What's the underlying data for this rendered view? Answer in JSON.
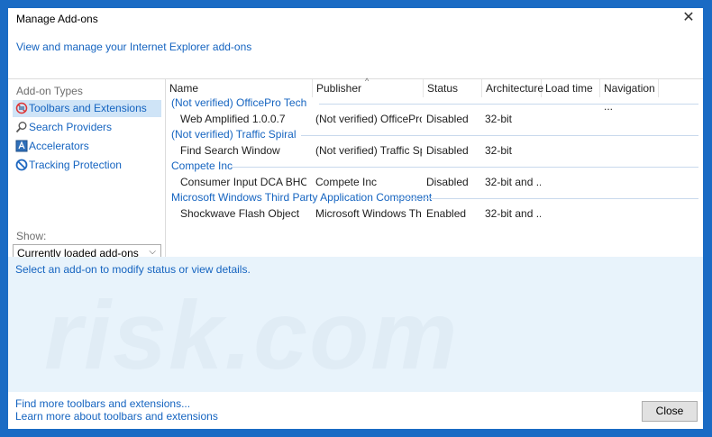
{
  "window": {
    "title": "Manage Add-ons",
    "subtitle": "View and manage your Internet Explorer add-ons"
  },
  "sidebar": {
    "group_label": "Add-on Types",
    "items": [
      {
        "label": "Toolbars and Extensions",
        "icon": "toolbar-icon",
        "selected": true
      },
      {
        "label": "Search Providers",
        "icon": "search-icon",
        "selected": false
      },
      {
        "label": "Accelerators",
        "icon": "accelerator-icon",
        "selected": false
      },
      {
        "label": "Tracking Protection",
        "icon": "block-icon",
        "selected": false
      }
    ],
    "show_label": "Show:",
    "show_value": "Currently loaded add-ons"
  },
  "table": {
    "columns": [
      "Name",
      "Publisher",
      "Status",
      "Architecture",
      "Load time",
      "Navigation ..."
    ],
    "groups": [
      {
        "name": "(Not verified) OfficePro Tech",
        "rows": [
          {
            "name": "Web Amplified 1.0.0.7",
            "publisher": "(Not verified) OfficePro T...",
            "status": "Disabled",
            "arch": "32-bit"
          }
        ]
      },
      {
        "name": "(Not verified) Traffic Spiral",
        "rows": [
          {
            "name": "Find Search Window",
            "publisher": "(Not verified) Traffic Spiral",
            "status": "Disabled",
            "arch": "32-bit"
          }
        ]
      },
      {
        "name": "Compete Inc",
        "rows": [
          {
            "name": "Consumer Input DCA BHO",
            "publisher": "Compete Inc",
            "status": "Disabled",
            "arch": "32-bit and ..."
          }
        ]
      },
      {
        "name": "Microsoft Windows Third Party Application Component",
        "rows": [
          {
            "name": "Shockwave Flash Object",
            "publisher": "Microsoft Windows Third...",
            "status": "Enabled",
            "arch": "32-bit and ..."
          }
        ]
      }
    ]
  },
  "status_text": "Select an add-on to modify status or view details.",
  "watermark": "risk.com",
  "footer": {
    "link1": "Find more toolbars and extensions...",
    "link2": "Learn more about toolbars and extensions",
    "close_label": "Close"
  },
  "colors": {
    "accent": "#1564c0",
    "frame": "#1a6bc4",
    "selection": "#cfe4f7"
  }
}
